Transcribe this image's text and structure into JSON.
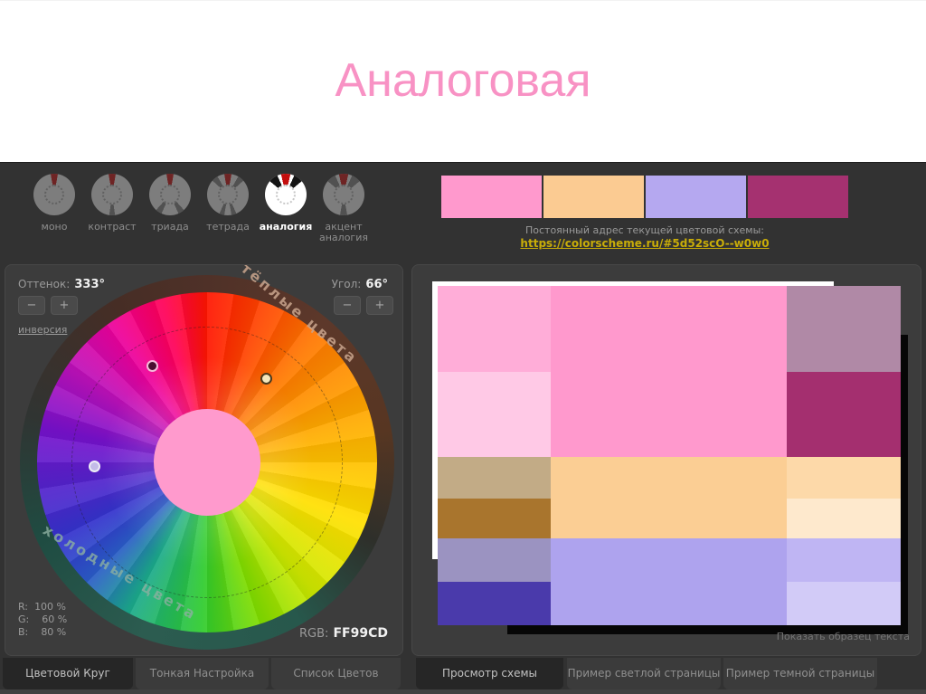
{
  "slide": {
    "title": "Аналоговая",
    "title_color": "#F892C4"
  },
  "toolbar": {
    "modes": [
      {
        "label": "моно"
      },
      {
        "label": "контраст"
      },
      {
        "label": "триада"
      },
      {
        "label": "тетрада"
      },
      {
        "label": "аналогия",
        "active": true
      },
      {
        "label": "акцент аналогия"
      }
    ],
    "swatches": [
      "#FF99CD",
      "#FBCB92",
      "#B5A8F0",
      "#A53170"
    ],
    "address_caption": "Постоянный адрес текущей цветовой схемы:",
    "address_link": "https://colorscheme.ru/#5d52scO--w0w0"
  },
  "wheel_panel": {
    "hue_label": "Оттенок:",
    "hue_value": "333°",
    "angle_label": "Угол:",
    "angle_value": "66°",
    "minus": "−",
    "plus": "+",
    "invert_link": "инверсия",
    "warm_label": "тёплые цвета",
    "cold_label": "холодные цвета",
    "center_color": "#FF9ACD",
    "marker_main_color": "#4A1030",
    "marker_warm_color": "#F4E7BD",
    "marker_cool_color": "#C3BBE8",
    "rgb": {
      "r_label": "R:",
      "r_value": "100 %",
      "g_label": "G:",
      "g_value": "60 %",
      "b_label": "B:",
      "b_value": "80 %"
    },
    "hex_label": "RGB:",
    "hex_value": "FF99CD"
  },
  "preview_panel": {
    "sample_text_link": "Показать образец текста",
    "blocks": {
      "l1": "#FFADD8",
      "l2": "#FFC9E6",
      "l3": "#C2AB86",
      "l4": "#A9752D",
      "l5": "#9B93C1",
      "l6": "#4A3AAB",
      "m1": "#FF99CD",
      "m2": "#FBCE94",
      "m3": "#AEA3EE",
      "r1": "#B089A6",
      "r2": "#A42F6F",
      "r3": "#FDD9A9",
      "r4": "#FEE9CD",
      "r5": "#BFB5F3",
      "r6": "#D2CBF7"
    }
  },
  "tabs_left": [
    {
      "label": "Цветовой Круг",
      "active": true
    },
    {
      "label": "Тонкая Настройка"
    },
    {
      "label": "Список Цветов"
    }
  ],
  "tabs_right": [
    {
      "label": "Просмотр схемы",
      "active": true
    },
    {
      "label": "Пример светлой страницы"
    },
    {
      "label": "Пример темной страницы"
    }
  ]
}
